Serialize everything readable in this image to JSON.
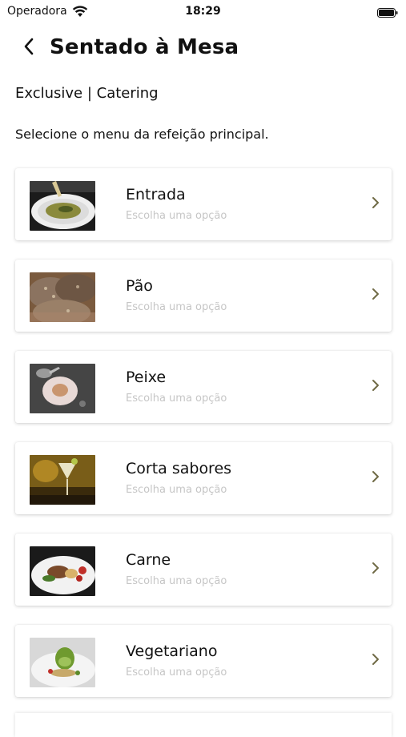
{
  "status": {
    "carrier": "Operadora",
    "time": "18:29"
  },
  "nav": {
    "title": "Sentado à Mesa"
  },
  "subtitle": "Exclusive | Catering",
  "instruction": "Selecione o menu da refeição principal.",
  "menu": [
    {
      "label": "Entrada",
      "hint": "Escolha uma opção",
      "image": "soup-dish"
    },
    {
      "label": "Pão",
      "hint": "Escolha uma opção",
      "image": "bread"
    },
    {
      "label": "Peixe",
      "hint": "Escolha uma opção",
      "image": "fish-plate"
    },
    {
      "label": "Corta sabores",
      "hint": "Escolha uma opção",
      "image": "cocktail"
    },
    {
      "label": "Carne",
      "hint": "Escolha uma opção",
      "image": "meat-plate"
    },
    {
      "label": "Vegetariano",
      "hint": "Escolha uma opção",
      "image": "vegetarian-plate"
    }
  ],
  "colors": {
    "chevron": "#6f6a45",
    "hint": "#c6c6c6"
  }
}
